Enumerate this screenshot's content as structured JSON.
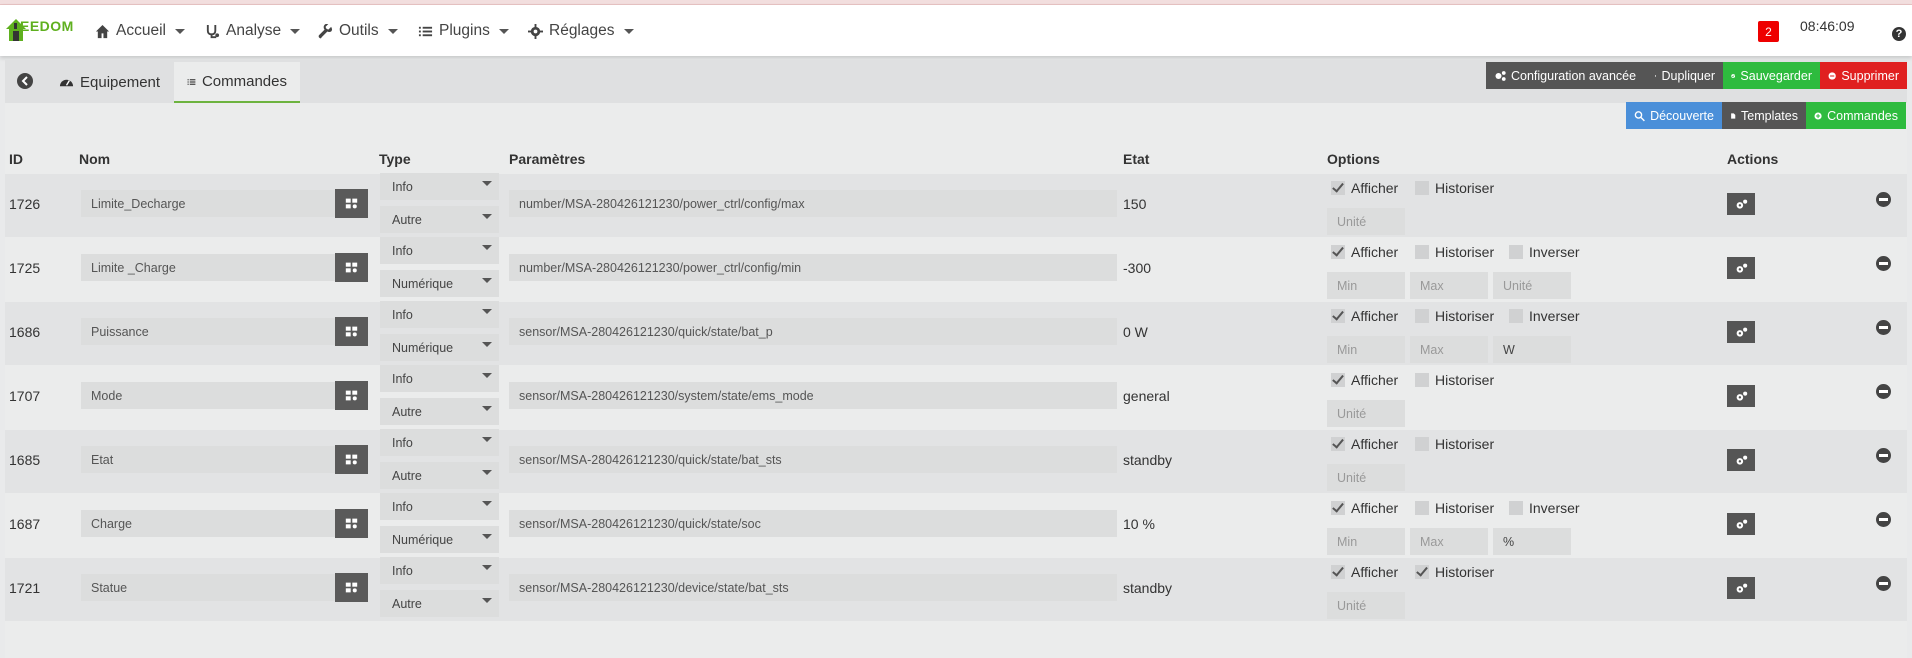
{
  "app": {
    "logo_text": "EEDOM",
    "badge": "2",
    "clock": "08:46:09",
    "help": "?"
  },
  "nav": [
    {
      "label": "Accueil",
      "icon": "home-icon"
    },
    {
      "label": "Analyse",
      "icon": "stethoscope-icon"
    },
    {
      "label": "Outils",
      "icon": "wrench-icon"
    },
    {
      "label": "Plugins",
      "icon": "list-icon"
    },
    {
      "label": "Réglages",
      "icon": "gear-icon"
    }
  ],
  "tabs": {
    "equipement": "Equipement",
    "commandes": "Commandes"
  },
  "toolbar": {
    "config": "Configuration avancée",
    "duplicate": "Dupliquer",
    "save": "Sauvegarder",
    "delete": "Supprimer",
    "discovery": "Découverte",
    "templates": "Templates",
    "commandes": "Commandes"
  },
  "columns": {
    "id": "ID",
    "name": "Nom",
    "type": "Type",
    "params": "Paramètres",
    "etat": "Etat",
    "options": "Options",
    "actions": "Actions"
  },
  "option_labels": {
    "afficher": "Afficher",
    "historiser": "Historiser",
    "inverser": "Inverser"
  },
  "placeholders": {
    "unite": "Unité",
    "min": "Min",
    "max": "Max"
  },
  "rows": [
    {
      "id": "1726",
      "name": "Limite_Decharge",
      "type": "Info",
      "subtype": "Autre",
      "param": "number/MSA-280426121230/power_ctrl/config/max",
      "etat": "150",
      "afficher": true,
      "historiser": false,
      "inverser": false,
      "unite": ""
    },
    {
      "id": "1725",
      "name": "Limite _Charge",
      "type": "Info",
      "subtype": "Numérique",
      "param": "number/MSA-280426121230/power_ctrl/config/min",
      "etat": "-300",
      "afficher": true,
      "historiser": false,
      "inverser": false,
      "unite": ""
    },
    {
      "id": "1686",
      "name": "Puissance",
      "type": "Info",
      "subtype": "Numérique",
      "param": "sensor/MSA-280426121230/quick/state/bat_p",
      "etat": "0 W",
      "afficher": true,
      "historiser": false,
      "inverser": false,
      "unite": "W"
    },
    {
      "id": "1707",
      "name": "Mode",
      "type": "Info",
      "subtype": "Autre",
      "param": "sensor/MSA-280426121230/system/state/ems_mode",
      "etat": "general",
      "afficher": true,
      "historiser": false,
      "inverser": false,
      "unite": ""
    },
    {
      "id": "1685",
      "name": "Etat",
      "type": "Info",
      "subtype": "Autre",
      "param": "sensor/MSA-280426121230/quick/state/bat_sts",
      "etat": "standby",
      "afficher": true,
      "historiser": false,
      "inverser": false,
      "unite": ""
    },
    {
      "id": "1687",
      "name": "Charge",
      "type": "Info",
      "subtype": "Numérique",
      "param": "sensor/MSA-280426121230/quick/state/soc",
      "etat": "10 %",
      "afficher": true,
      "historiser": false,
      "inverser": false,
      "unite": "%"
    },
    {
      "id": "1721",
      "name": "Statue",
      "type": "Info",
      "subtype": "Autre",
      "param": "sensor/MSA-280426121230/device/state/bat_sts",
      "etat": "standby",
      "afficher": true,
      "historiser": true,
      "inverser": false,
      "unite": ""
    }
  ]
}
